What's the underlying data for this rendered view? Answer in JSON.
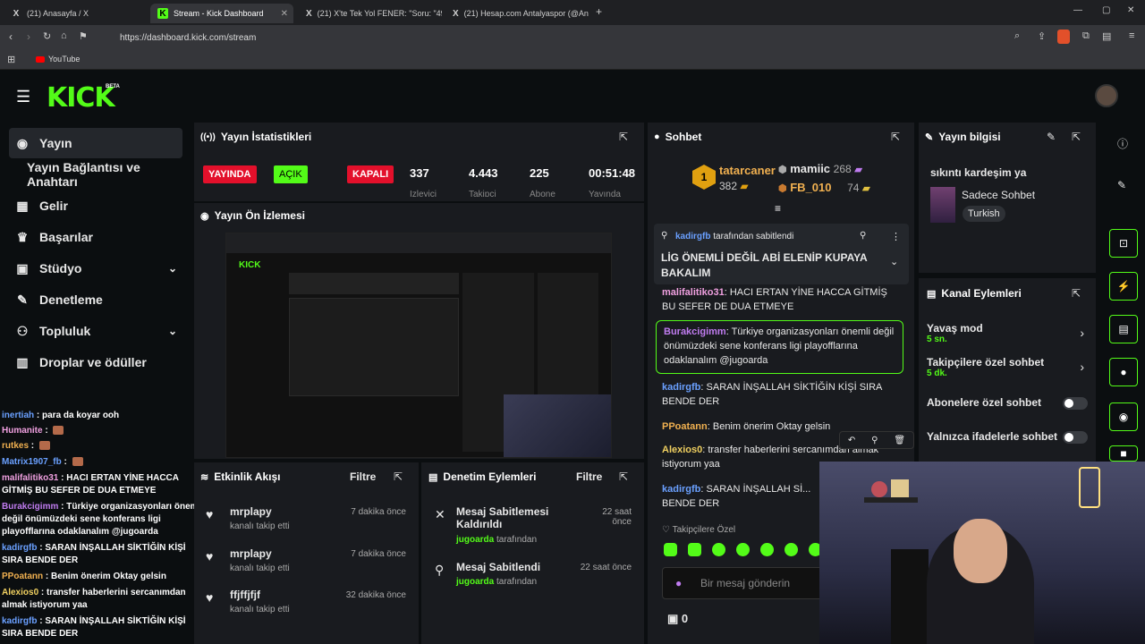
{
  "browser": {
    "tabs": [
      {
        "icon": "X",
        "label": "(21) Anasayfa / X"
      },
      {
        "icon": "K",
        "label": "Stream - Kick Dashboard"
      },
      {
        "icon": "X",
        "label": "(21) X'te Tek Yol FENER: \"Soru: \"49. d"
      },
      {
        "icon": "X",
        "label": "(21) Hesap.com Antalyaspor (@Antal"
      }
    ],
    "url": "https://dashboard.kick.com/stream",
    "bookmark": "YouTube"
  },
  "kick": {
    "logo": "KICK",
    "beta": "BETA",
    "sidebar": [
      {
        "label": "Yayın",
        "icon": "((•))"
      },
      {
        "label": "Yayın Bağlantısı ve Anahtarı",
        "icon": ""
      },
      {
        "label": "Gelir",
        "icon": "▦"
      },
      {
        "label": "Başarılar",
        "icon": "🏆"
      },
      {
        "label": "Stüdyo",
        "icon": "▣"
      },
      {
        "label": "Denetleme",
        "icon": "✎"
      },
      {
        "label": "Topluluk",
        "icon": "⚲"
      },
      {
        "label": "Droplar ve ödüller",
        "icon": "▥"
      }
    ],
    "stats": {
      "title": "Yayın İstatistikleri",
      "live": "YAYINDA",
      "open": "AÇIK",
      "closed": "KAPALI",
      "viewers": "337",
      "viewers_label": "İzleyici",
      "followers": "4.443",
      "followers_label": "Takipçi",
      "subs": "225",
      "subs_label": "Abone",
      "time": "00:51:48",
      "time_label": "Yayında"
    },
    "preview": {
      "title": "Yayın Ön İzlemesi"
    },
    "activity": {
      "title": "Etkinlik Akışı",
      "filter": "Filtre",
      "items": [
        {
          "name": "mrplapy",
          "desc": "kanalı takip etti",
          "time": "7 dakika önce"
        },
        {
          "name": "mrplapy",
          "desc": "kanalı takip etti",
          "time": "7 dakika önce"
        },
        {
          "name": "ffjffjfjf",
          "desc": "kanalı takip etti",
          "time": "32 dakika önce"
        }
      ]
    },
    "modactions": {
      "title": "Denetim Eylemleri",
      "filter": "Filtre",
      "items": [
        {
          "title": "Mesaj Sabitlemesi Kaldırıldı",
          "by": "jugoarda",
          "by_suffix": "tarafından",
          "time": "22 saat önce"
        },
        {
          "title": "Mesaj Sabitlendi",
          "by": "jugoarda",
          "by_suffix": "tarafından",
          "time": "22 saat önce"
        }
      ]
    },
    "chat": {
      "title": "Sohbet",
      "top1": {
        "rank": "1",
        "name": "tatarcaner",
        "score": "382"
      },
      "top2": {
        "name": "mamiic",
        "score": "268"
      },
      "top3": {
        "name": "FB_010",
        "score": "74"
      },
      "pinned_by": "kadirgfb",
      "pinned_suffix": "tarafından sabitlendi",
      "pinned_text": "LİG ÖNEMLİ DEĞİL ABİ ELENİP KUPAYA BAKALIM",
      "messages": [
        {
          "user": "malifalitiko31",
          "text": "HACI ERTAN YİNE HACCA GİTMİŞ BU SEFER DE DUA ETMEYE",
          "color": "#f0a0e0"
        },
        {
          "user": "Burakcigimm",
          "text": "Türkiye organizasyonları önemli değil önümüzdeki sene konferans ligi playofflarına odaklanalım @jugoarda",
          "color": "#c07cf0"
        },
        {
          "user": "kadirgfb",
          "text": "SARAN İNŞALLAH SİKTİĞİN KİŞİ SIRA BENDE DER",
          "color": "#6aa0ff"
        },
        {
          "user": "PPoatann",
          "text": "Benim önerim Oktay gelsin",
          "color": "#f0b050"
        },
        {
          "user": "Alexios0",
          "text": "transfer haberlerini sercanımdan almak istiyorum yaa",
          "color": "#f0d060"
        },
        {
          "user": "kadirgfb",
          "text": "SARAN İNŞALLAH Sİ... BENDE DER",
          "color": "#6aa0ff"
        }
      ],
      "followers_only": "Takipçilere Özel",
      "input_placeholder": "Bir mesaj gönderin",
      "points": "0"
    },
    "streaminfo": {
      "title": "Yayın bilgisi",
      "stream_title": "sıkıntı kardeşim ya",
      "category": "Sadece Sohbet",
      "language": "Turkish"
    },
    "channelactions": {
      "title": "Kanal Eylemleri",
      "slow": "Yavaş mod",
      "slow_val": "5 sn.",
      "followers": "Takipçilere özel sohbet",
      "followers_val": "5 dk.",
      "subs": "Abonelere özel sohbet",
      "emotes": "Yalnızca ifadelerle sohbet"
    }
  },
  "overlay_chat": [
    {
      "user": "inertiah",
      "text": "para da koyar ooh",
      "color": "#6aa0ff"
    },
    {
      "user": "Humanite",
      "text": "",
      "color": "#f0a0e0"
    },
    {
      "user": "rutkes",
      "text": "",
      "color": "#f0b050"
    },
    {
      "user": "Matrix1907_fb",
      "text": "",
      "color": "#6aa0ff"
    },
    {
      "user": "malifalitiko31",
      "text": "HACI ERTAN YİNE HACCA GİTMİŞ BU SEFER DE DUA ETMEYE",
      "color": "#f0a0e0"
    },
    {
      "user": "Burakcigimm",
      "text": "Türkiye organizasyonları önemli değil önümüzdeki sene konferans ligi playofflarına odaklanalım @jugoarda",
      "color": "#c07cf0"
    },
    {
      "user": "kadirgfb",
      "text": "SARAN İNŞALLAH SİKTİĞİN KİŞİ SIRA BENDE DER",
      "color": "#6aa0ff"
    },
    {
      "user": "PPoatann",
      "text": "Benim önerim Oktay gelsin",
      "color": "#f0b050"
    },
    {
      "user": "Alexios0",
      "text": "transfer haberlerini sercanımdan almak istiyorum yaa",
      "color": "#f0d060"
    },
    {
      "user": "kadirgfb",
      "text": "SARAN İNŞALLAH SİKTİĞİN KİŞİ SIRA BENDE DER",
      "color": "#6aa0ff"
    }
  ],
  "colors": {
    "accent": "#53fc18",
    "live": "#e3102b",
    "panel": "#191b1f"
  }
}
